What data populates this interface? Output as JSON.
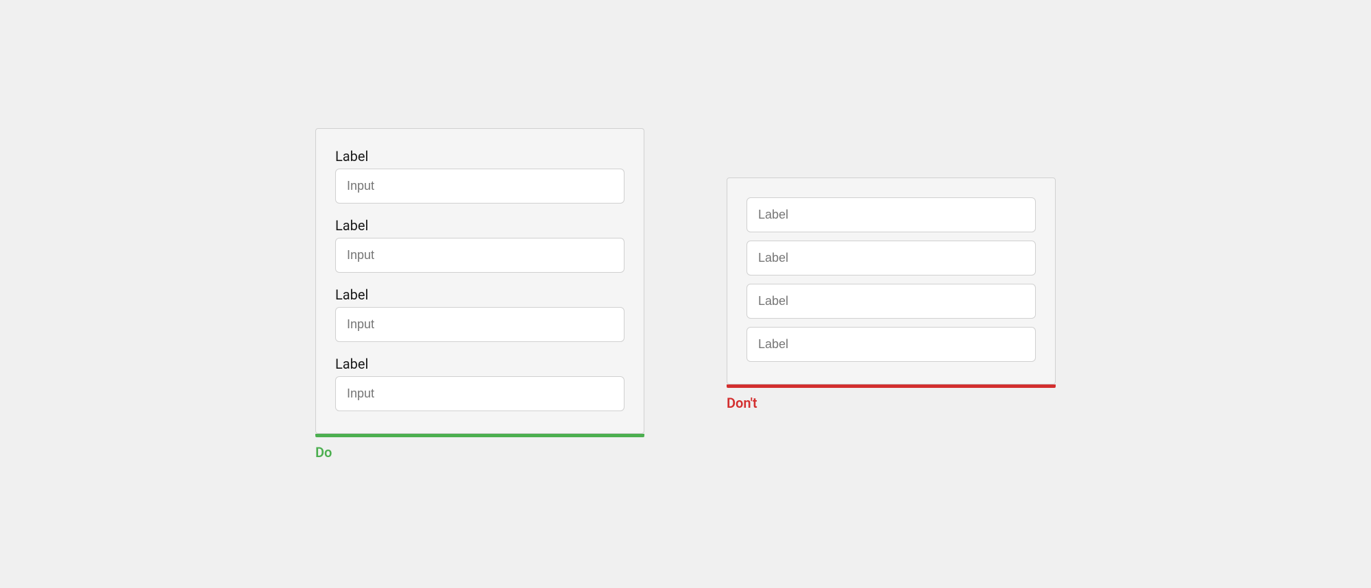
{
  "do_example": {
    "card_label": "Do",
    "fields": [
      {
        "label": "Label",
        "placeholder": "Input"
      },
      {
        "label": "Label",
        "placeholder": "Input"
      },
      {
        "label": "Label",
        "placeholder": "Input"
      },
      {
        "label": "Label",
        "placeholder": "Input"
      }
    ]
  },
  "dont_example": {
    "card_label": "Don't",
    "fields": [
      {
        "placeholder": "Label"
      },
      {
        "placeholder": "Label"
      },
      {
        "placeholder": "Label"
      },
      {
        "placeholder": "Label"
      }
    ]
  },
  "colors": {
    "green": "#4caf50",
    "red": "#d32f2f"
  }
}
